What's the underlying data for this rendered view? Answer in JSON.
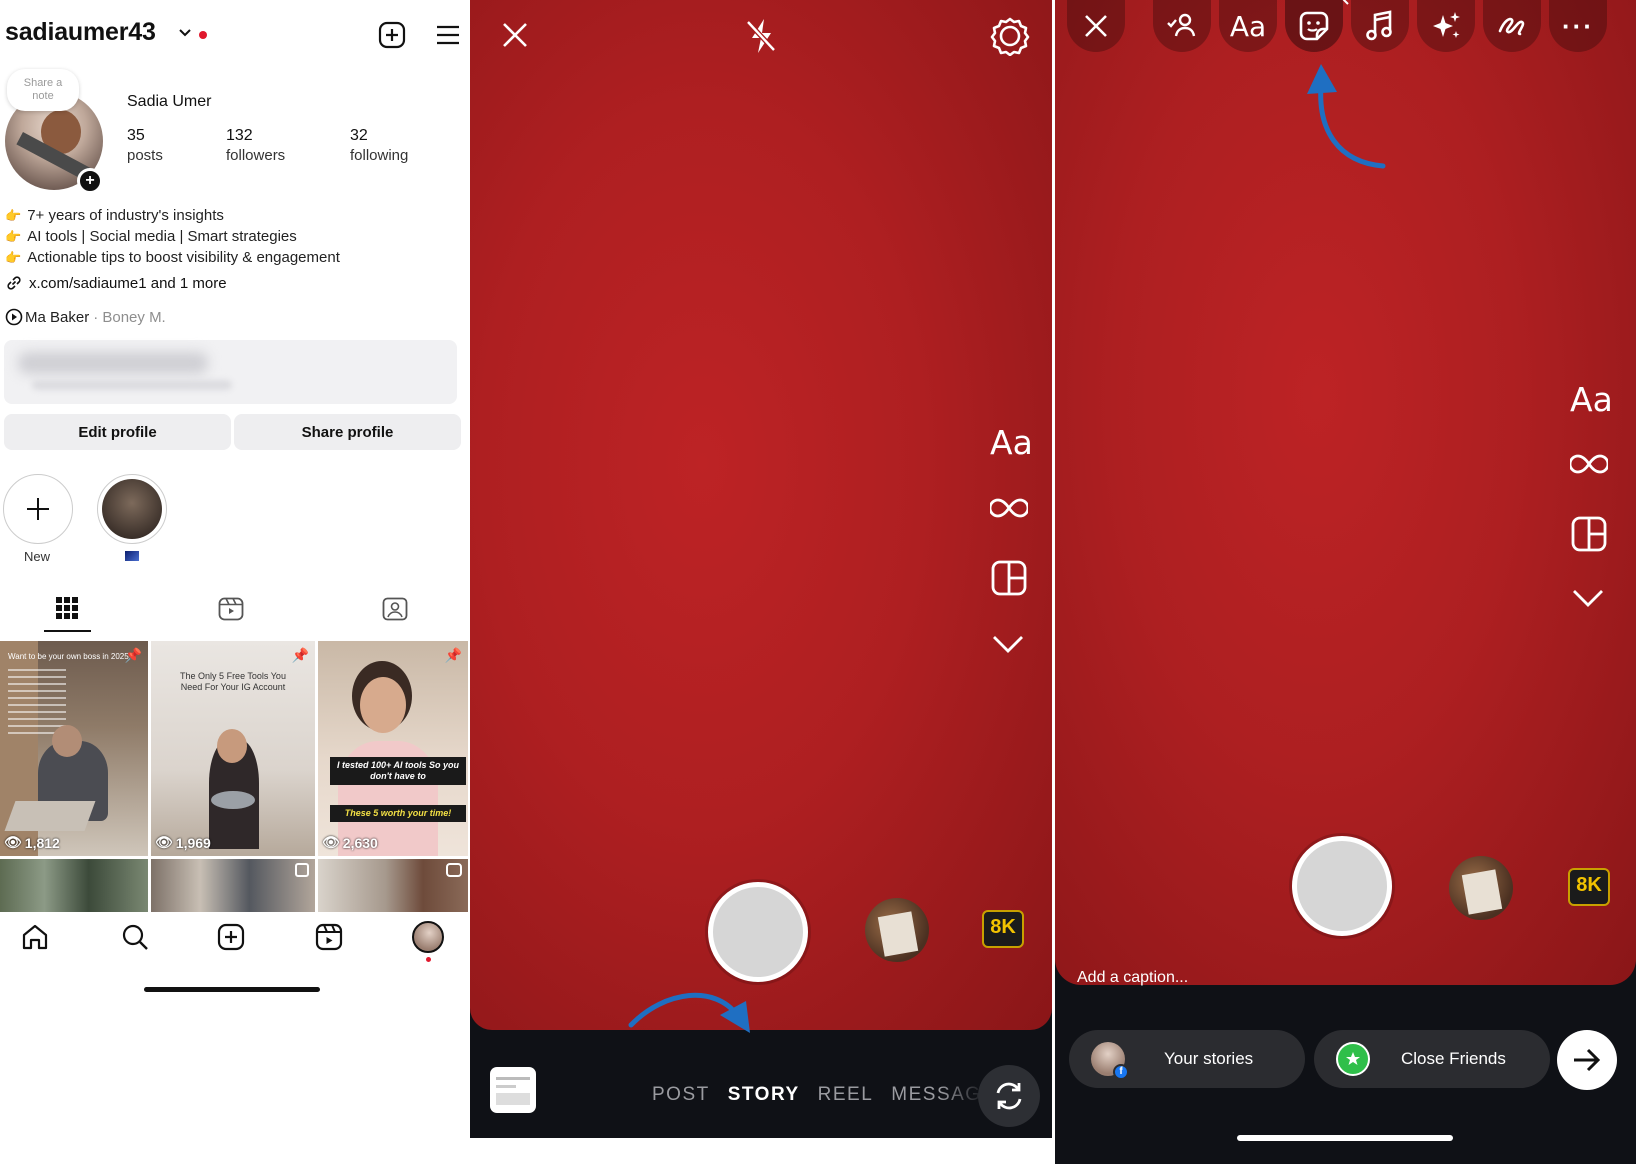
{
  "profile": {
    "username": "sadiaumer43",
    "note_label": "Share a note",
    "display_name": "Sadia Umer",
    "stats": [
      {
        "value": "35",
        "label": "posts"
      },
      {
        "value": "132",
        "label": "followers"
      },
      {
        "value": "32",
        "label": "following"
      }
    ],
    "bio": [
      "7+ years of industry's insights",
      "AI tools | Social media | Smart strategies",
      "Actionable tips to boost visibility & engagement"
    ],
    "link": "x.com/sadiaume1 and 1 more",
    "music": {
      "song": "Ma Baker",
      "artist": "· Boney M."
    },
    "buttons": {
      "edit": "Edit profile",
      "share": "Share profile"
    },
    "highlights": [
      {
        "label": "New"
      },
      {
        "label": ""
      }
    ],
    "posts": [
      {
        "views": "1,812",
        "pinned": true,
        "caption": "Want to be your own boss in 2025"
      },
      {
        "views": "1,969",
        "pinned": true,
        "caption": "The Only 5 Free Tools You Need For Your IG Account"
      },
      {
        "views": "2,630",
        "pinned": true,
        "caption": "I tested 100+ AI tools So you don't have to",
        "caption2": "These 5 worth your time!"
      }
    ]
  },
  "camera": {
    "side_text_tool": "Aa",
    "modes": [
      "POST",
      "STORY",
      "REEL",
      "MESSAGE"
    ],
    "active_mode": "STORY",
    "effect_badge": "8K"
  },
  "story_editor": {
    "text_tool": "Aa",
    "side_text_tool": "Aa",
    "caption_placeholder": "Add a caption...",
    "share_your_stories": "Your stories",
    "share_close_friends": "Close Friends",
    "effect_badge": "8K"
  },
  "colors": {
    "story_red": "#b42022",
    "annotation_arrow": "#1f6fc2",
    "close_friends_green": "#2fbf4a",
    "notification_red": "#e0182d"
  }
}
